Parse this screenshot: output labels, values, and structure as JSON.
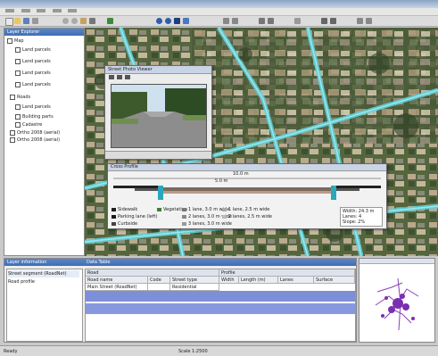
{
  "layers_panel": {
    "title": "Layer Explorer",
    "items": [
      {
        "label": "Map"
      },
      {
        "label": "Land parcels"
      },
      {
        "label": "Land parcels"
      },
      {
        "label": "Land parcels"
      },
      {
        "label": "Land parcels"
      },
      {
        "label": "Roads"
      },
      {
        "label": "Land parcels"
      },
      {
        "label": "Building parts"
      },
      {
        "label": "Cadastre"
      },
      {
        "label": "Ortho 2008 (aerial)"
      },
      {
        "label": "Ortho 2008 (aerial)"
      }
    ]
  },
  "photo_window": {
    "title": "Street Photo Viewer"
  },
  "profile_window": {
    "title": "Cross Profile",
    "scale_top": "10.0 m",
    "scale_mid": "5.0 m",
    "legend": [
      {
        "label": "Sidewalk",
        "color": "#222222"
      },
      {
        "label": "Parking lane (left)",
        "color": "#1a1a1a"
      },
      {
        "label": "Curbside",
        "color": "#444444"
      },
      {
        "label": "Vegetation",
        "color": "#3a7f3a"
      },
      {
        "label": "1 lane, 3.0 m wide",
        "color": "#777777"
      },
      {
        "label": "2 lanes, 3.0 m wide",
        "color": "#888888"
      },
      {
        "label": "3 lanes, 3.0 m wide",
        "color": "#999999"
      },
      {
        "label": "1 lane, 2.5 m wide",
        "color": "#aaaaaa"
      },
      {
        "label": "2 lanes, 2.5 m wide",
        "color": "#bbbbbb"
      }
    ],
    "info": [
      "Width: 24.3 m",
      "Lanes: 4",
      "Slope: 2%"
    ]
  },
  "bottom_panel": {
    "tabs": [
      "Layer information",
      "Data Table"
    ],
    "left_rows": [
      "Street segment (RoadNet)",
      "Road profile"
    ],
    "table": {
      "group1": "Road",
      "group2": "Profile",
      "columns": [
        "Road name",
        "Code",
        "Street type",
        "Width",
        "Length (m)",
        "Lanes",
        "Surface"
      ],
      "rows": [
        [
          "Main Street (RoadNet)",
          "",
          "Residential",
          "",
          "",
          "",
          ""
        ],
        [
          "",
          "",
          "",
          "",
          "",
          "",
          ""
        ]
      ]
    }
  },
  "statusbar": {
    "left": "Ready",
    "mid": "Scale 1:2500"
  },
  "colors": {
    "accent": "#4a78c2",
    "selection": "#7d8fd9"
  }
}
